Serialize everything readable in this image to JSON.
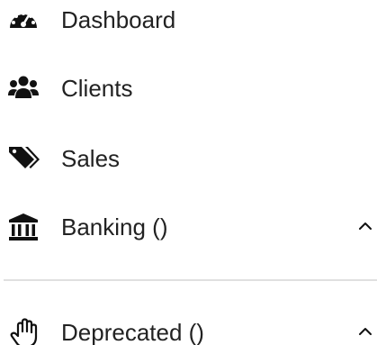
{
  "nav": {
    "items": [
      {
        "label": "Dashboard",
        "icon": "dashboard-icon"
      },
      {
        "label": "Clients",
        "icon": "users-icon"
      },
      {
        "label": "Sales",
        "icon": "tags-icon"
      },
      {
        "label": "Banking ()",
        "icon": "bank-icon",
        "expandable": true,
        "expanded": true
      },
      {
        "label": "Deprecated ()",
        "icon": "hand-icon",
        "expandable": true,
        "expanded": true
      }
    ]
  },
  "colors": {
    "text": "#222222",
    "icon": "#111111",
    "divider": "#e0e0e0",
    "background": "#ffffff"
  }
}
